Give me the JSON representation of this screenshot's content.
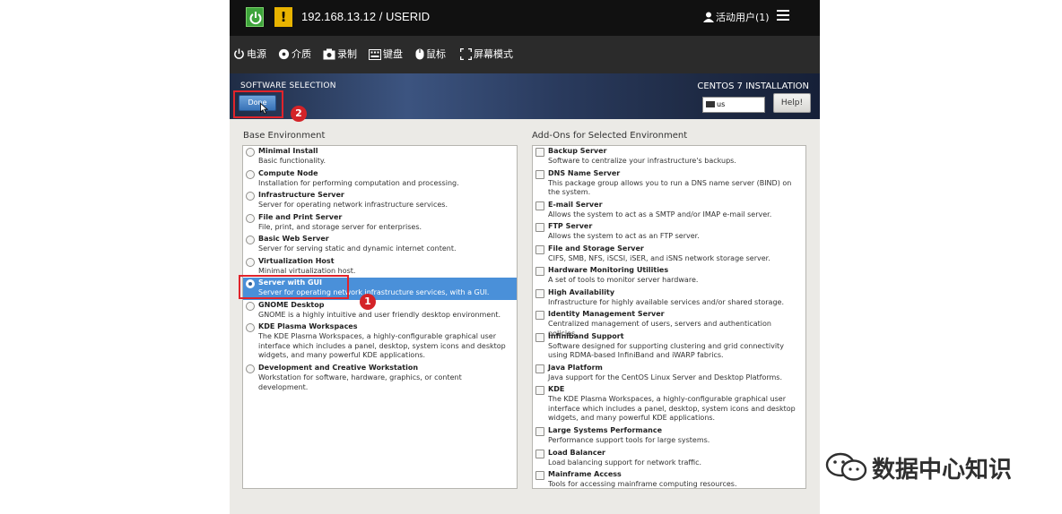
{
  "remote": {
    "host": "192.168.13.12 / USERID",
    "users": "活动用户(1)",
    "toolbar": [
      "电源",
      "介质",
      "录制",
      "键盘",
      "鼠标",
      "屏幕模式"
    ]
  },
  "installer": {
    "page_title": "SOFTWARE SELECTION",
    "done_label": "Done",
    "install_title": "CENTOS 7 INSTALLATION",
    "keyboard_layout": "us",
    "help_label": "Help!",
    "accent_color": "#4a90d9"
  },
  "base": {
    "label": "Base Environment",
    "items": [
      {
        "name": "Minimal Install",
        "desc": "Basic functionality."
      },
      {
        "name": "Compute Node",
        "desc": "Installation for performing computation and processing."
      },
      {
        "name": "Infrastructure Server",
        "desc": "Server for operating network infrastructure services."
      },
      {
        "name": "File and Print Server",
        "desc": "File, print, and storage server for enterprises."
      },
      {
        "name": "Basic Web Server",
        "desc": "Server for serving static and dynamic internet content."
      },
      {
        "name": "Virtualization Host",
        "desc": "Minimal virtualization host."
      },
      {
        "name": "Server with GUI",
        "desc": "Server for operating network infrastructure services, with a GUI.",
        "selected": true
      },
      {
        "name": "GNOME Desktop",
        "desc": "GNOME is a highly intuitive and user friendly desktop environment."
      },
      {
        "name": "KDE Plasma Workspaces",
        "desc": "The KDE Plasma Workspaces, a highly-configurable graphical user interface which includes a panel, desktop, system icons and desktop widgets, and many powerful KDE applications."
      },
      {
        "name": "Development and Creative Workstation",
        "desc": "Workstation for software, hardware, graphics, or content development."
      }
    ]
  },
  "addons": {
    "label": "Add-Ons for Selected Environment",
    "items": [
      {
        "name": "Backup Server",
        "desc": "Software to centralize your infrastructure's backups."
      },
      {
        "name": "DNS Name Server",
        "desc": "This package group allows you to run a DNS name server (BIND) on the system."
      },
      {
        "name": "E-mail Server",
        "desc": "Allows the system to act as a SMTP and/or IMAP e-mail server."
      },
      {
        "name": "FTP Server",
        "desc": "Allows the system to act as an FTP server."
      },
      {
        "name": "File and Storage Server",
        "desc": "CIFS, SMB, NFS, iSCSI, iSER, and iSNS network storage server."
      },
      {
        "name": "Hardware Monitoring Utilities",
        "desc": "A set of tools to monitor server hardware."
      },
      {
        "name": "High Availability",
        "desc": "Infrastructure for highly available services and/or shared storage."
      },
      {
        "name": "Identity Management Server",
        "desc": "Centralized management of users, servers and authentication policies."
      },
      {
        "name": "Infiniband Support",
        "desc": "Software designed for supporting clustering and grid connectivity using RDMA-based InfiniBand and iWARP fabrics."
      },
      {
        "name": "Java Platform",
        "desc": "Java support for the CentOS Linux Server and Desktop Platforms."
      },
      {
        "name": "KDE",
        "desc": "The KDE Plasma Workspaces, a highly-configurable graphical user interface which includes a panel, desktop, system icons and desktop widgets, and many powerful KDE applications."
      },
      {
        "name": "Large Systems Performance",
        "desc": "Performance support tools for large systems."
      },
      {
        "name": "Load Balancer",
        "desc": "Load balancing support for network traffic."
      },
      {
        "name": "Mainframe Access",
        "desc": "Tools for accessing mainframe computing resources."
      }
    ]
  },
  "annotations": {
    "step_1": "1",
    "step_2": "2"
  },
  "watermark": "数据中心知识"
}
